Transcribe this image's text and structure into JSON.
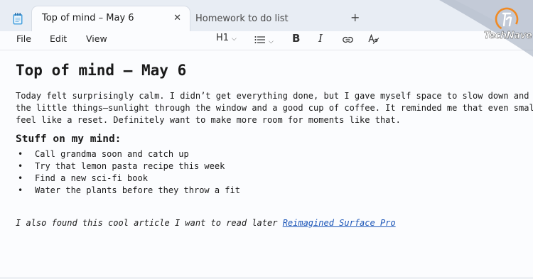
{
  "tabs": [
    {
      "title": "Top of mind – May 6",
      "active": true
    },
    {
      "title": "Homework to do list",
      "active": false
    }
  ],
  "tab_close_glyph": "✕",
  "new_tab_glyph": "+",
  "menu": [
    "File",
    "Edit",
    "View"
  ],
  "format": {
    "heading": "H1",
    "bold": "B",
    "italic": "I",
    "spell_icon": "spellcheck-icon",
    "link_icon": "link-icon",
    "list_icon": "list-icon"
  },
  "document": {
    "title": "Top of mind – May 6",
    "paragraph_lines": [
      "Today felt surprisingly calm. I didn’t get everything done, but I gave myself space to slow down and just",
      "the little things—sunlight through the window and a good cup of coffee. It reminded me that even small pa",
      "feel like a reset. Definitely want to make more room for moments like that."
    ],
    "subheading": "Stuff on my mind:",
    "bullets": [
      "Call grandma soon and catch up",
      "Try that lemon pasta recipe this week",
      "Find a new sci-fi book",
      "Water the plants before they throw a fit"
    ],
    "note_prefix": "I also found this cool article I want to read later ",
    "note_link": "Reimagined Surface Pro"
  },
  "watermark": {
    "text": "TechNave",
    "logo_icon": "technave-logo-icon"
  },
  "colors": {
    "accent_orange": "#f08a24",
    "link_blue": "#1c56b8",
    "tabbar": "#e8edf4"
  }
}
